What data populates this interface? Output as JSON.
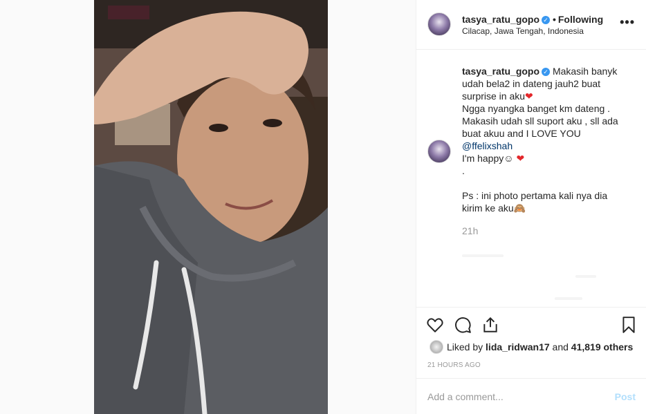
{
  "post": {
    "username": "tasya_ratu_gopo",
    "follow_status": "Following",
    "location": "Cilacap, Jawa Tengah, Indonesia",
    "more_label": "•••"
  },
  "caption": {
    "username": "tasya_ratu_gopo",
    "line1": "Makasih banyk",
    "line2": "udah bela2 in dateng jauh2 buat",
    "line3": "surprise in aku",
    "line4": "Ngga nyangka banget km dateng .",
    "line5": "Makasih udah sll suport aku , sll ada",
    "line6": "buat akuu and I LOVE YOU",
    "mention": "@ffelixshah",
    "line7": "I'm happy",
    "smile": "☺",
    "heart": "❤",
    "dot": ".",
    "line8": "Ps : ini photo pertama kali nya dia",
    "line9": "kirim ke aku",
    "monkey": "🙈",
    "time_ago": "21h"
  },
  "likes": {
    "prefix": "Liked by",
    "user": "lida_ridwan17",
    "connector": "and",
    "count": "41,819 others"
  },
  "date_label": "21 HOURS AGO",
  "comment": {
    "placeholder": "Add a comment...",
    "post_label": "Post"
  },
  "colors": {
    "verified": "#3897f0",
    "heart": "#e3282c",
    "post_disabled": "#b2dffc",
    "mention": "#003569"
  },
  "icons": [
    "heart-icon",
    "comment-icon",
    "share-icon",
    "bookmark-icon",
    "verified-icon",
    "more-icon"
  ]
}
